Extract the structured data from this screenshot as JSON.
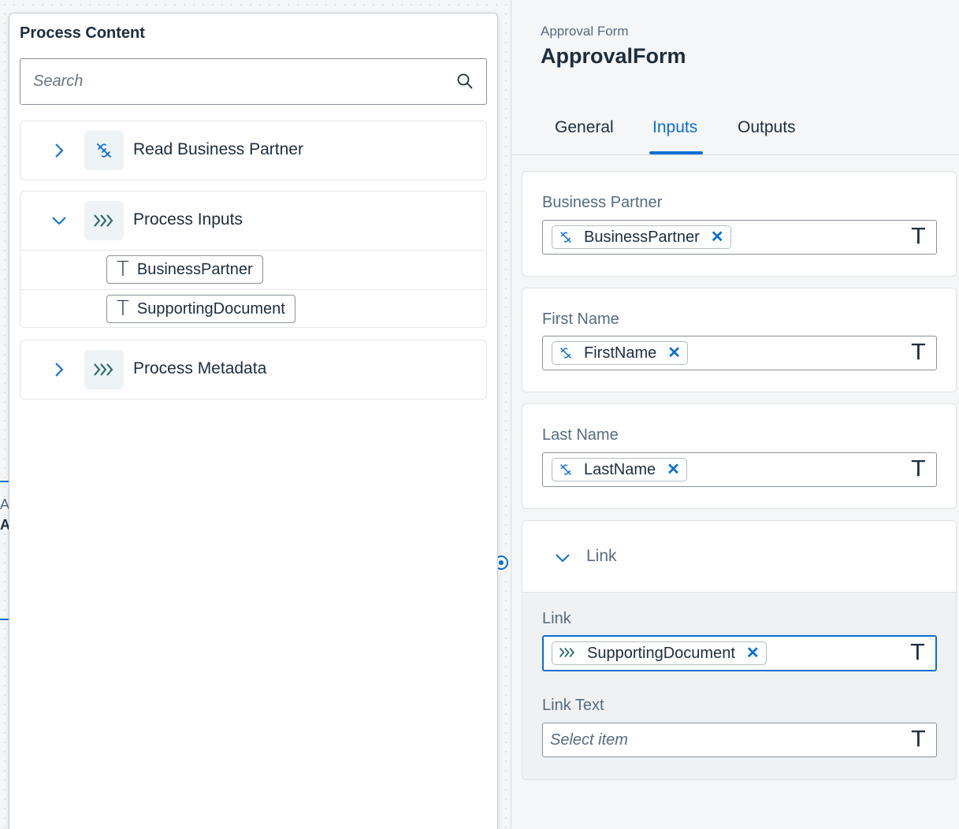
{
  "canvas": {
    "fragment_top": "Ap",
    "fragment_bottom": "A"
  },
  "process_content": {
    "title": "Process Content",
    "search": {
      "placeholder": "Search",
      "value": ""
    },
    "groups": [
      {
        "label": "Read Business Partner",
        "icon": "unlink-icon",
        "expanded": false,
        "children": []
      },
      {
        "label": "Process Inputs",
        "icon": "process-chevrons-icon",
        "expanded": true,
        "children": [
          {
            "label": "BusinessPartner",
            "icon": "text-type-icon"
          },
          {
            "label": "SupportingDocument",
            "icon": "text-type-icon"
          }
        ]
      },
      {
        "label": "Process Metadata",
        "icon": "process-chevrons-icon",
        "expanded": false,
        "children": []
      }
    ]
  },
  "panel": {
    "subtitle": "Approval Form",
    "title": "ApprovalForm",
    "tabs": [
      {
        "label": "General",
        "active": false
      },
      {
        "label": "Inputs",
        "active": true
      },
      {
        "label": "Outputs",
        "active": false
      }
    ],
    "fields": [
      {
        "label": "Business Partner",
        "token": "BusinessPartner",
        "token_icon": "unlink-icon",
        "type_icon": "T"
      },
      {
        "label": "First Name",
        "token": "FirstName",
        "token_icon": "unlink-icon",
        "type_icon": "T"
      },
      {
        "label": "Last Name",
        "token": "LastName",
        "token_icon": "unlink-icon",
        "type_icon": "T"
      }
    ],
    "link_section": {
      "header": "Link",
      "expanded": true,
      "link_field": {
        "label": "Link",
        "token": "SupportingDocument",
        "token_icon": "process-chevrons-icon",
        "type_icon": "T"
      },
      "link_text_field": {
        "label": "Link Text",
        "placeholder": "Select item",
        "type_icon": "T"
      }
    }
  },
  "colors": {
    "accent": "#0a6ed1",
    "text": "#1d2d3e",
    "muted": "#556b82",
    "icon_teal": "#2f6f6f"
  }
}
